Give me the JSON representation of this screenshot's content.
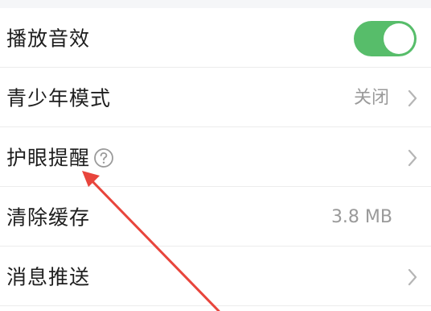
{
  "settings": {
    "items": [
      {
        "label": "播放音效",
        "control": "toggle",
        "toggle_on": true
      },
      {
        "label": "青少年模式",
        "value": "关闭",
        "control": "chevron"
      },
      {
        "label": "护眼提醒",
        "control": "chevron",
        "has_help": true
      },
      {
        "label": "清除缓存",
        "value": "3.8 MB",
        "control": "none"
      },
      {
        "label": "消息推送",
        "control": "chevron"
      }
    ]
  },
  "icons": {
    "toggle": "toggle-switch",
    "chevron": "chevron-right-icon",
    "help": "question-circle-icon",
    "annotation": "red-arrow-icon"
  },
  "colors": {
    "toggle_on": "#57bd6a",
    "label_text": "#1e1e1e",
    "value_text": "#9a9a9a",
    "chevron": "#b5b5b5",
    "annotation_arrow": "#e8453c"
  }
}
